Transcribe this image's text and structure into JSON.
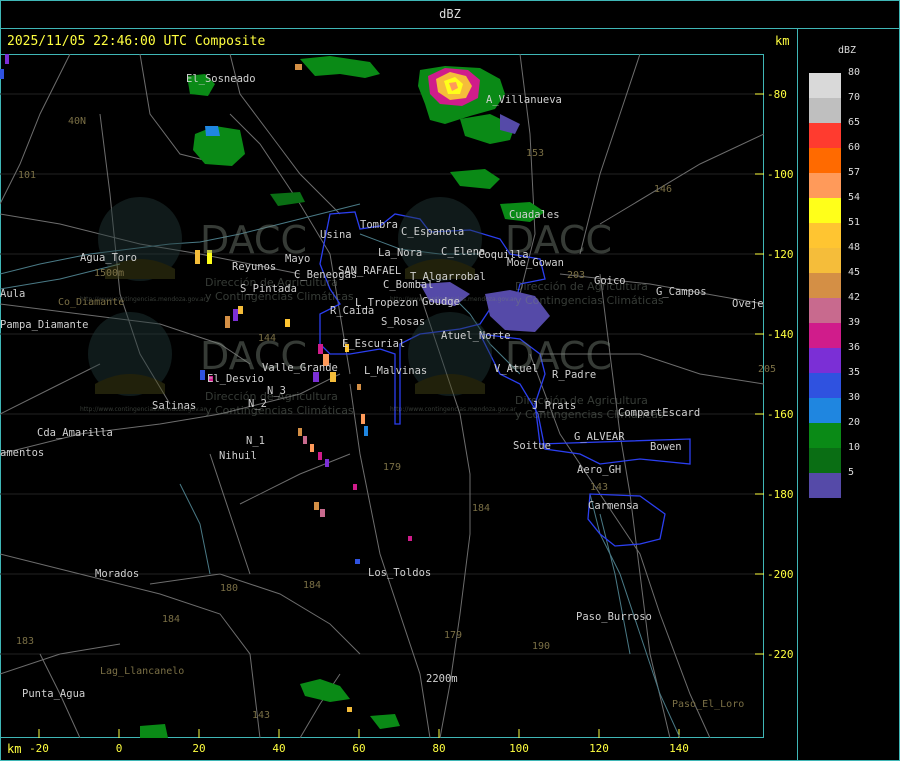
{
  "header": {
    "title": "dBZ"
  },
  "map": {
    "timestamp": "2025/11/05 22:46:00 UTC Composite",
    "unit_top": "km",
    "unit_bottom": "km",
    "y_ticks": [
      "-80",
      "-100",
      "-120",
      "-140",
      "-160",
      "-180",
      "-200",
      "-220"
    ],
    "x_ticks": [
      "-20",
      "0",
      "20",
      "40",
      "60",
      "80",
      "100",
      "120",
      "140"
    ],
    "places": [
      "El_Sosneado",
      "A_Villanueva",
      "40N",
      "101",
      "153",
      "146",
      "Cuadales",
      "Tombra",
      "Usina",
      "C_Espanola",
      "Agua_Toro",
      "1500m",
      "Reyunos",
      "Mayo",
      "C_Beneogas",
      "SAN_RAFAEL",
      "La_Nora",
      "C_Elena",
      "Coquilla",
      "Moe_Gowan",
      "203",
      "Goico",
      "G_Campos",
      "Oveje",
      "Aula",
      "Co_Diamante",
      "Pampa_Diamante",
      "S_Pintada",
      "T_Algarrobal",
      "C_Bombal",
      "L_Tropezon",
      "Goudge",
      "R_Caida",
      "S_Rosas",
      "Atuel_Norte",
      "E_Escurial",
      "144",
      "El_Desvio",
      "Valle_Grande",
      "L_Malvinas",
      "V_Atuel",
      "R_Padre",
      "205",
      "Salinas",
      "N_3",
      "N_2",
      "J_Prats",
      "CompartEscard",
      "Cda_Amarilla",
      "N_1",
      "G_ALVEAR",
      "Bowen",
      "amentos",
      "Nihuil",
      "Soitue",
      "Aero_GH",
      "179",
      "143",
      "184",
      "Carmensa",
      "Morados",
      "180",
      "184",
      "Los_Toldos",
      "Paso_Burroso",
      "184",
      "179",
      "190",
      "183",
      "Lag_Llancanelo",
      "Punta_Agua",
      "2200m",
      "143",
      "Paso_El_Loro"
    ],
    "watermark": {
      "logo_text": "DACC",
      "line1": "Dirección de Agricultura",
      "line2": "y Contingencias Climáticas",
      "url": "http://www.contingencias.mendoza.gov.ar"
    }
  },
  "legend": {
    "title": "dBZ",
    "items": [
      {
        "label": "80",
        "color": "#d9d9d9"
      },
      {
        "label": "70",
        "color": "#bfbfbf"
      },
      {
        "label": "65",
        "color": "#ff3b2f"
      },
      {
        "label": "60",
        "color": "#ff6a00"
      },
      {
        "label": "57",
        "color": "#ff9a5a"
      },
      {
        "label": "54",
        "color": "#ffff1a"
      },
      {
        "label": "51",
        "color": "#ffc531"
      },
      {
        "label": "48",
        "color": "#f5bd3a"
      },
      {
        "label": "45",
        "color": "#d48f45"
      },
      {
        "label": "42",
        "color": "#c86a8e"
      },
      {
        "label": "39",
        "color": "#d01c8b"
      },
      {
        "label": "36",
        "color": "#7b2fd6"
      },
      {
        "label": "35",
        "color": "#2f52e0"
      },
      {
        "label": "30",
        "color": "#1f86e0"
      },
      {
        "label": "20",
        "color": "#0a8a16"
      },
      {
        "label": "10",
        "color": "#0a6e14"
      },
      {
        "label": "5",
        "color": "#554aa8"
      }
    ]
  }
}
